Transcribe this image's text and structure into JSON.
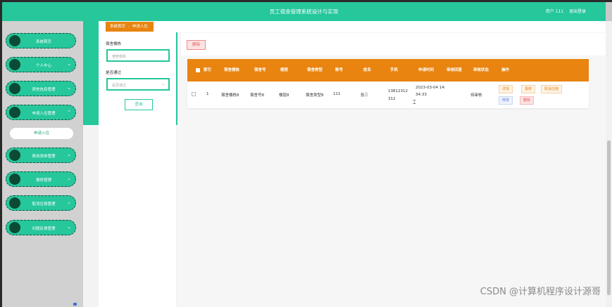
{
  "header": {
    "title": "员工宿舍管理系统设计与实现",
    "user": "用户 111",
    "logout": "退出登录"
  },
  "sidebar": {
    "items": [
      {
        "label": "系统首页",
        "has_chevron": false
      },
      {
        "label": "个人中心",
        "has_chevron": true
      },
      {
        "label": "宿舍信息管理",
        "has_chevron": true
      },
      {
        "label": "申请入住管理",
        "has_chevron": true,
        "expanded": true
      },
      {
        "label": "费用清单管理",
        "has_chevron": true
      },
      {
        "label": "报修管理",
        "has_chevron": true
      },
      {
        "label": "取消住宿管理",
        "has_chevron": true
      },
      {
        "label": "问题反馈管理",
        "has_chevron": true
      }
    ],
    "sub_item": "申请入住"
  },
  "breadcrumb": {
    "home": "系统首页",
    "separator": ":",
    "current": "申请入住"
  },
  "search": {
    "field1_label": "宿舍楼栋",
    "field1_placeholder": "宿舍楼栋",
    "field2_label": "是否通过",
    "field2_placeholder": "是否通过",
    "query_button": "查询"
  },
  "toolbar": {
    "delete_label": "删除"
  },
  "table": {
    "headers": [
      "索引",
      "宿舍楼栋",
      "宿舍号",
      "楼层",
      "宿舍类型",
      "账号",
      "姓名",
      "手机",
      "申请时间",
      "审核回复",
      "审核状态",
      "操作"
    ],
    "rows": [
      {
        "index": "1",
        "building": "宿舍楼栋8",
        "room": "宿舍号8",
        "floor": "楼层8",
        "type": "宿舍类型8",
        "account": "111",
        "name": "张三",
        "phone": "13812312312",
        "apply_time": "2023-03-04 14:34:33",
        "reply": "",
        "status": "待审核"
      }
    ],
    "actions": {
      "detail": "详情",
      "repair": "报修",
      "cancel": "取消住宿",
      "edit": "修改",
      "delete": "删除"
    }
  },
  "watermark": "CSDN @计算机程序设计源哥",
  "colors": {
    "accent": "#25c79b",
    "orange": "#e8840f",
    "danger": "#e05b5b"
  }
}
